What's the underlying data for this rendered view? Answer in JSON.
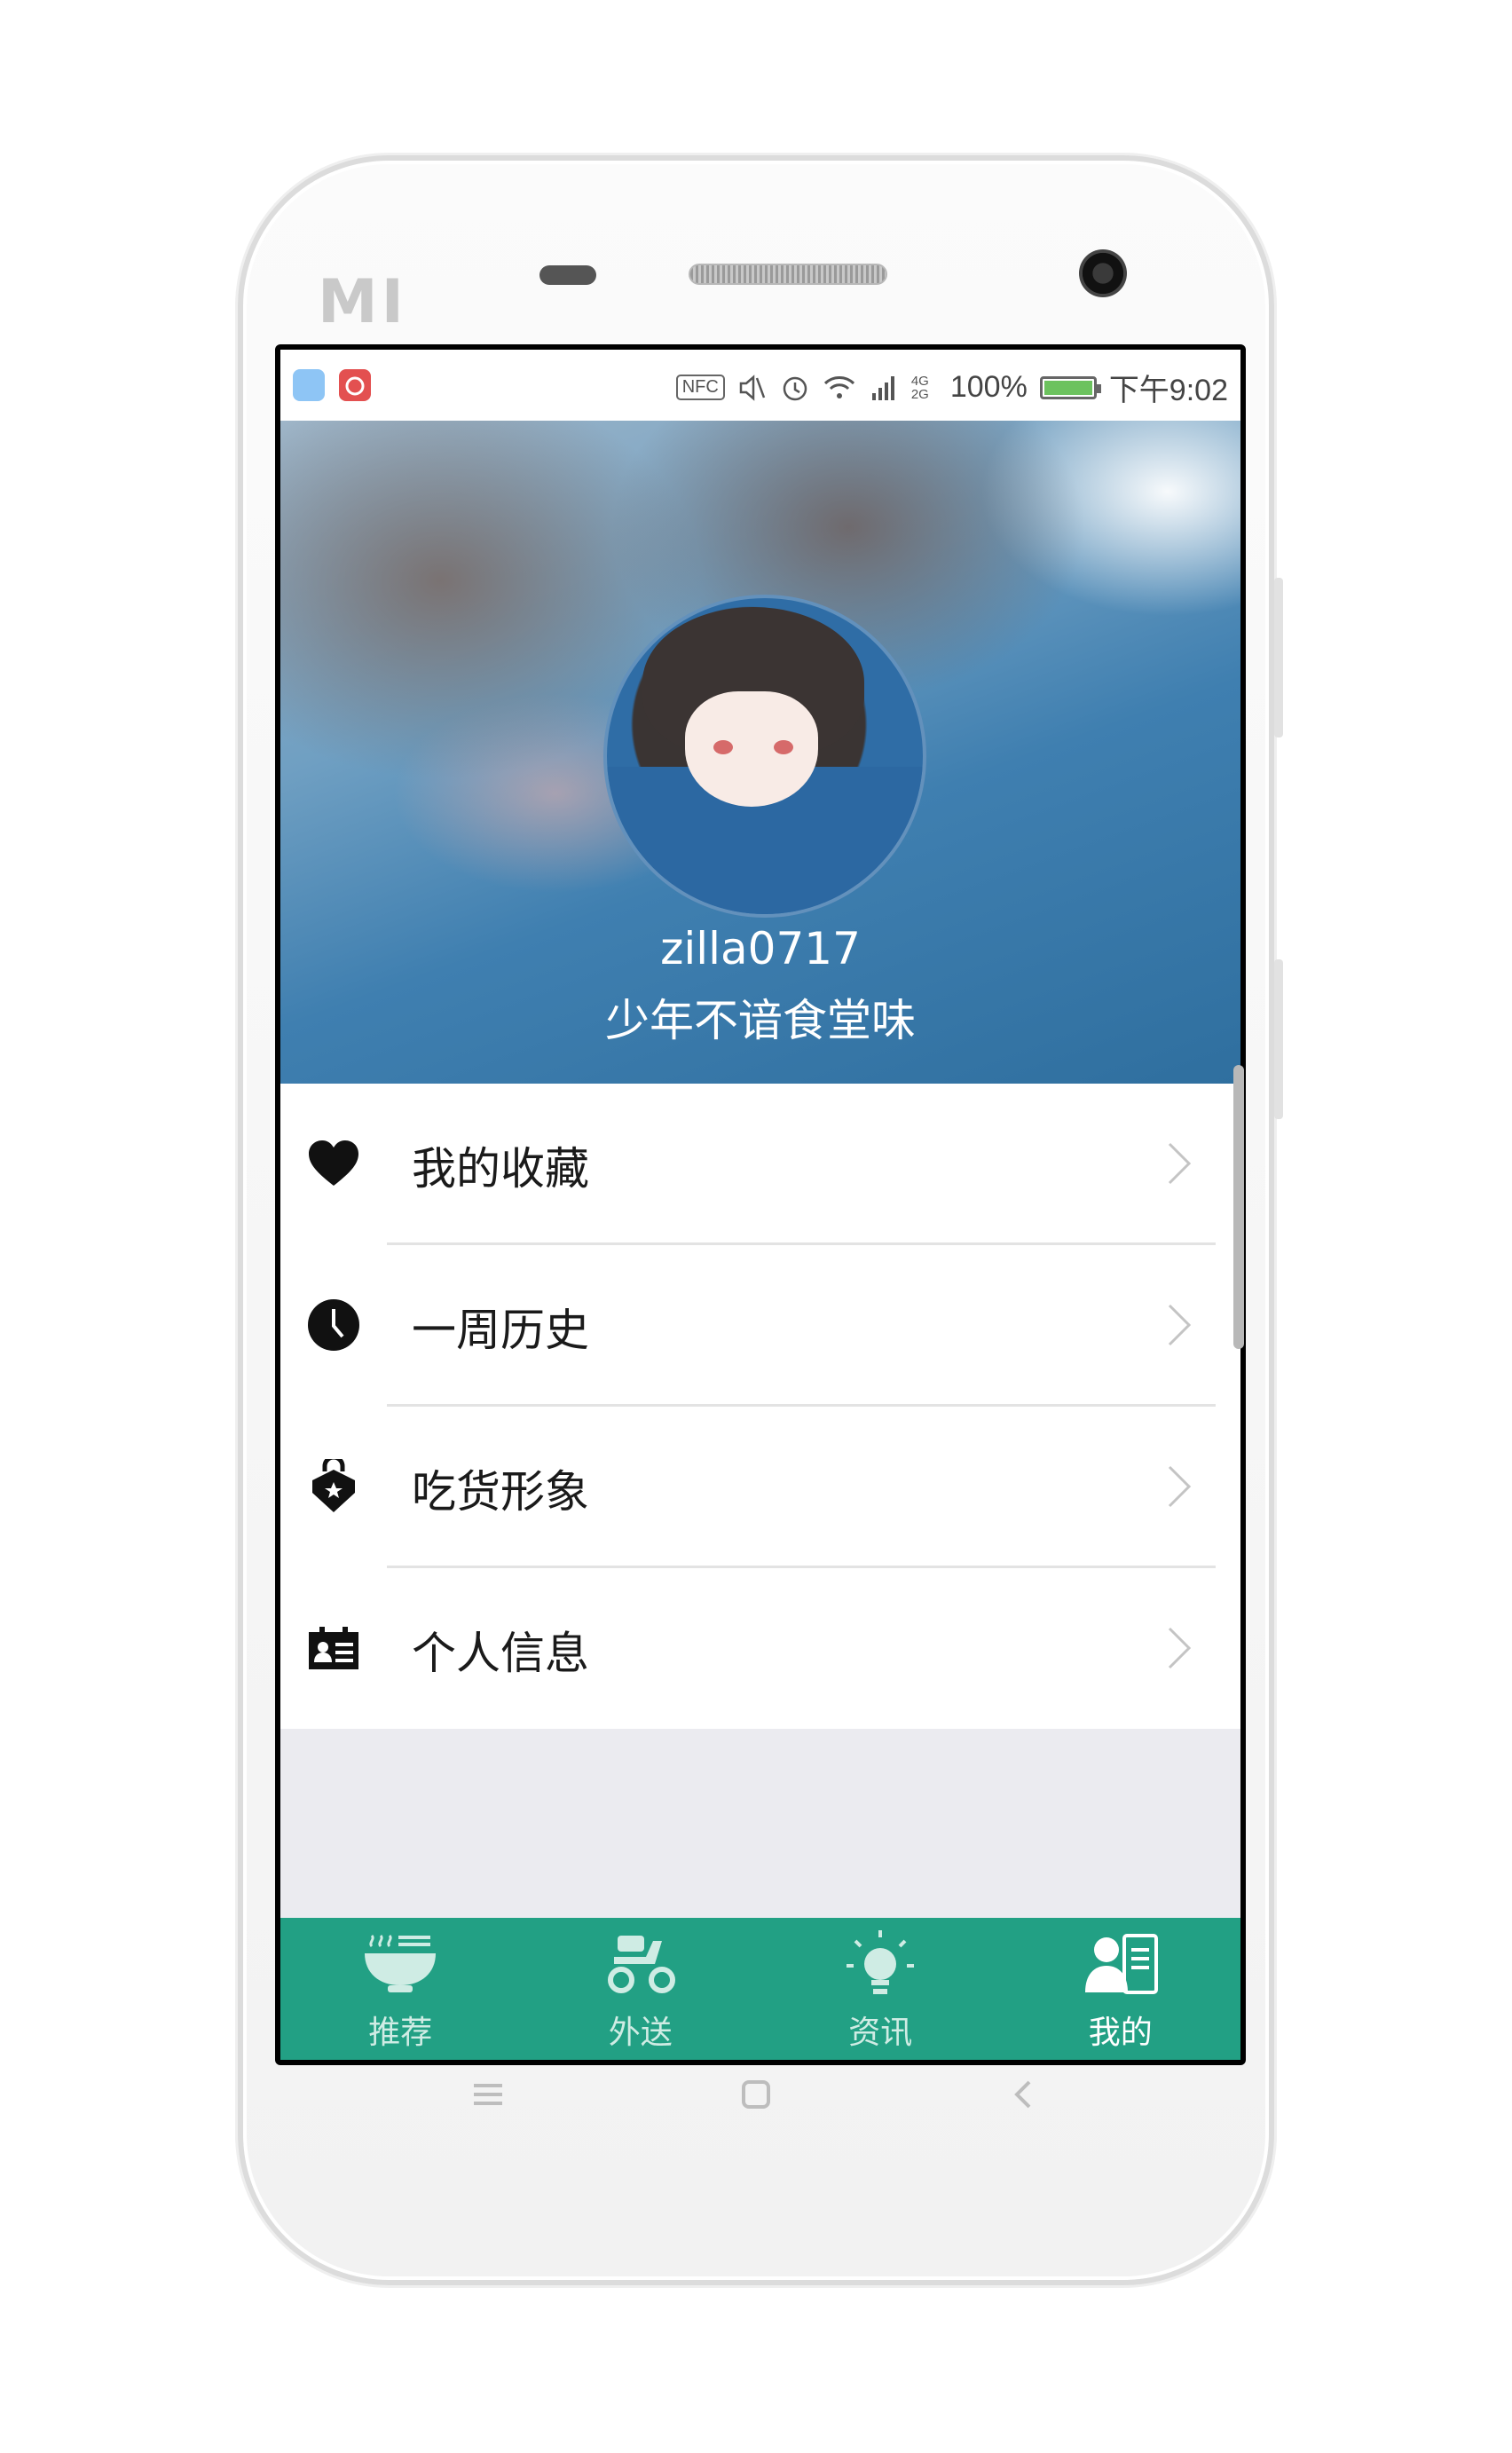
{
  "statusbar": {
    "nfc_label": "NFC",
    "network_label": "4G 2G",
    "battery_percent": "100%",
    "battery_level": 1.0,
    "time": "下午9:02",
    "icons": [
      "app-icon-blue",
      "netease-music-icon",
      "mute-icon",
      "alarm-icon",
      "wifi-icon",
      "signal-icon"
    ]
  },
  "profile": {
    "username": "zilla0717",
    "motto": "少年不谙食堂味"
  },
  "menu": {
    "items": [
      {
        "label": "我的收藏",
        "icon": "heart-icon"
      },
      {
        "label": "一周历史",
        "icon": "clock-icon"
      },
      {
        "label": "吃货形象",
        "icon": "star-badge-icon"
      },
      {
        "label": "个人信息",
        "icon": "id-card-icon"
      }
    ]
  },
  "tabs": [
    {
      "label": "推荐",
      "icon": "bowl-icon",
      "active": false
    },
    {
      "label": "外送",
      "icon": "scooter-icon",
      "active": false
    },
    {
      "label": "资讯",
      "icon": "lightbulb-icon",
      "active": false
    },
    {
      "label": "我的",
      "icon": "profile-card-icon",
      "active": true
    }
  ],
  "colors": {
    "tab_bar": "#22a084",
    "tab_label_inactive": "#cfece4",
    "tab_label_active": "#ffffff",
    "menu_text": "#1a1a1a",
    "page_background": "#ebebf0"
  },
  "device": {
    "brand_logo": "MI"
  }
}
